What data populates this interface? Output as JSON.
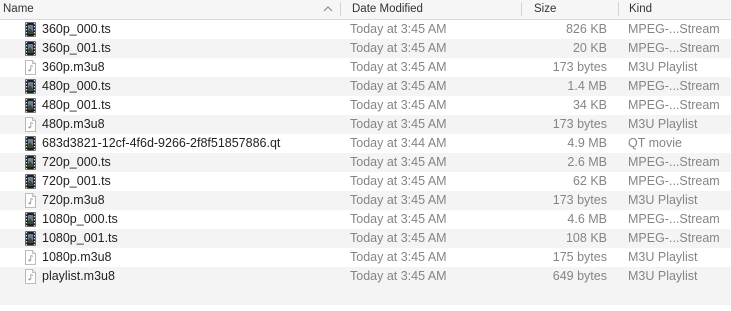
{
  "columns": {
    "name": "Name",
    "date_modified": "Date Modified",
    "size": "Size",
    "kind": "Kind"
  },
  "files": [
    {
      "name": "360p_000.ts",
      "date": "Today at 3:45 AM",
      "size": "826 KB",
      "kind": "MPEG-...Stream",
      "icon": "video-file-icon"
    },
    {
      "name": "360p_001.ts",
      "date": "Today at 3:45 AM",
      "size": "20 KB",
      "kind": "MPEG-...Stream",
      "icon": "video-file-icon"
    },
    {
      "name": "360p.m3u8",
      "date": "Today at 3:45 AM",
      "size": "173 bytes",
      "kind": "M3U Playlist",
      "icon": "playlist-file-icon"
    },
    {
      "name": "480p_000.ts",
      "date": "Today at 3:45 AM",
      "size": "1.4 MB",
      "kind": "MPEG-...Stream",
      "icon": "video-file-icon"
    },
    {
      "name": "480p_001.ts",
      "date": "Today at 3:45 AM",
      "size": "34 KB",
      "kind": "MPEG-...Stream",
      "icon": "video-file-icon"
    },
    {
      "name": "480p.m3u8",
      "date": "Today at 3:45 AM",
      "size": "173 bytes",
      "kind": "M3U Playlist",
      "icon": "playlist-file-icon"
    },
    {
      "name": "683d3821-12cf-4f6d-9266-2f8f51857886.qt",
      "date": "Today at 3:44 AM",
      "size": "4.9 MB",
      "kind": "QT movie",
      "icon": "video-file-icon"
    },
    {
      "name": "720p_000.ts",
      "date": "Today at 3:45 AM",
      "size": "2.6 MB",
      "kind": "MPEG-...Stream",
      "icon": "video-file-icon"
    },
    {
      "name": "720p_001.ts",
      "date": "Today at 3:45 AM",
      "size": "62 KB",
      "kind": "MPEG-...Stream",
      "icon": "video-file-icon"
    },
    {
      "name": "720p.m3u8",
      "date": "Today at 3:45 AM",
      "size": "173 bytes",
      "kind": "M3U Playlist",
      "icon": "playlist-file-icon"
    },
    {
      "name": "1080p_000.ts",
      "date": "Today at 3:45 AM",
      "size": "4.6 MB",
      "kind": "MPEG-...Stream",
      "icon": "video-file-icon"
    },
    {
      "name": "1080p_001.ts",
      "date": "Today at 3:45 AM",
      "size": "108 KB",
      "kind": "MPEG-...Stream",
      "icon": "video-file-icon"
    },
    {
      "name": "1080p.m3u8",
      "date": "Today at 3:45 AM",
      "size": "175 bytes",
      "kind": "M3U Playlist",
      "icon": "playlist-file-icon"
    },
    {
      "name": "playlist.m3u8",
      "date": "Today at 3:45 AM",
      "size": "649 bytes",
      "kind": "M3U Playlist",
      "icon": "playlist-file-icon"
    }
  ],
  "colors": {
    "header_bg": "#f6f6f6",
    "alt_row_bg": "#f4f4f5",
    "secondary_text": "#858585"
  }
}
